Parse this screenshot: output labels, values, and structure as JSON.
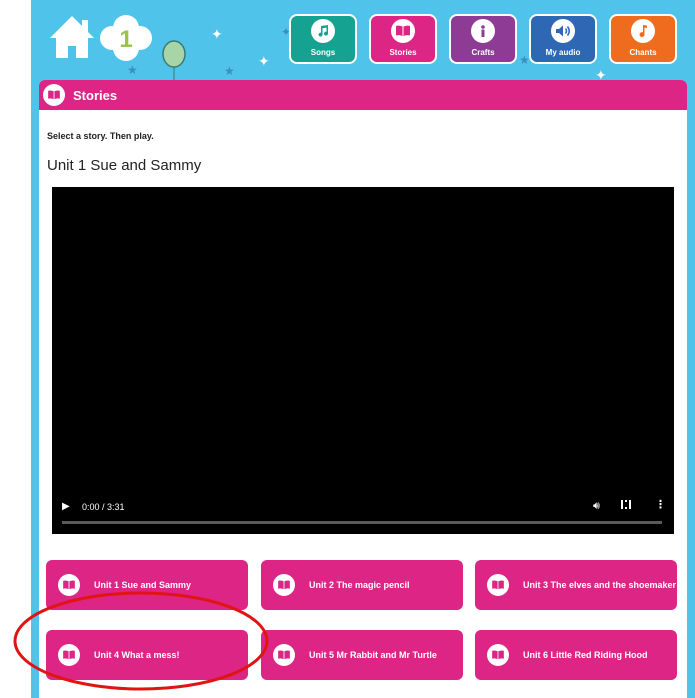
{
  "nav": {
    "home_icon": "home-icon",
    "level_badge": "1",
    "buttons": [
      {
        "label": "Songs",
        "icon": "music-note-icon",
        "color": "#16a291"
      },
      {
        "label": "Stories",
        "icon": "book-icon",
        "color": "#dc2584"
      },
      {
        "label": "Crafts",
        "icon": "info-icon",
        "color": "#8e3b96"
      },
      {
        "label": "My audio",
        "icon": "speaker-icon",
        "color": "#2e67b3"
      },
      {
        "label": "Chants",
        "icon": "music-note-icon",
        "color": "#ef6c1f"
      }
    ]
  },
  "panel": {
    "title": "Stories",
    "instruction": "Select a story. Then play.",
    "current_story": "Unit 1 Sue and Sammy"
  },
  "video": {
    "time": "0:00 / 3:31",
    "progress": 0
  },
  "stories": [
    {
      "label": "Unit 1 Sue and Sammy"
    },
    {
      "label": "Unit 2 The magic pencil"
    },
    {
      "label": "Unit 3 The elves and the shoemaker"
    },
    {
      "label": "Unit 4 What a mess!"
    },
    {
      "label": "Unit 5 Mr Rabbit and Mr Turtle"
    },
    {
      "label": "Unit 6 Little Red Riding Hood"
    }
  ],
  "colors": {
    "accent": "#dc2584",
    "background": "#4fc3ea",
    "annotation": "#e11414"
  }
}
